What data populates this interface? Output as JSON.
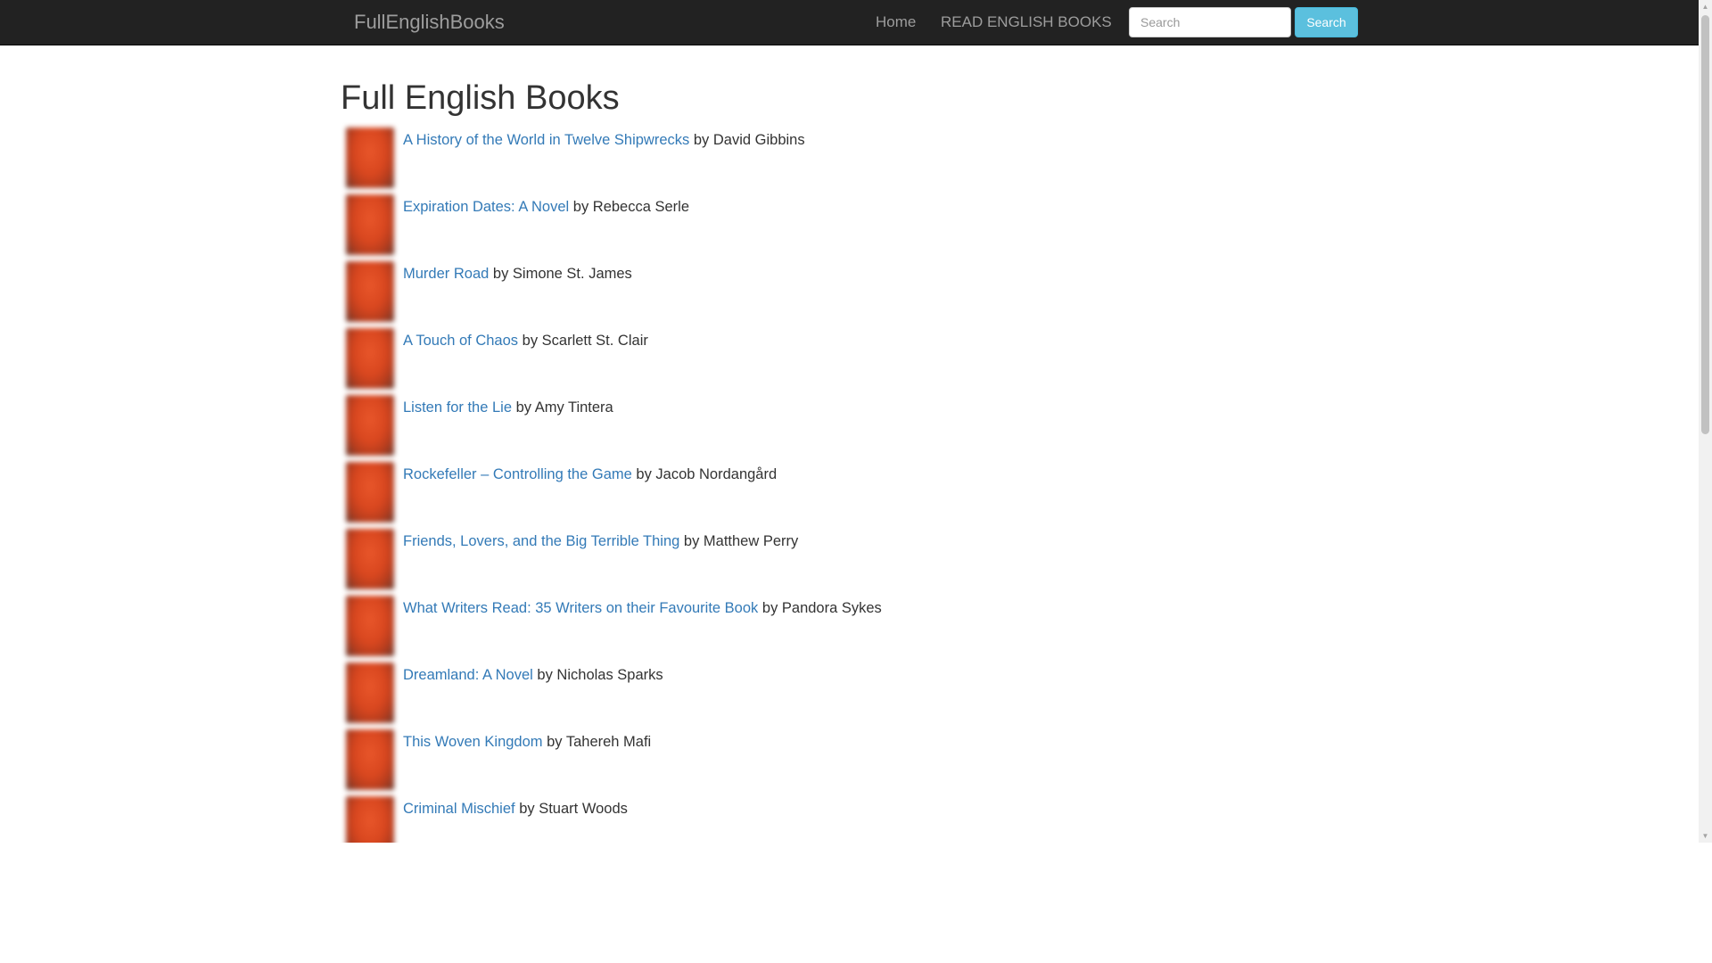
{
  "navbar": {
    "brand": "FullEnglishBooks",
    "links": [
      {
        "label": "Home"
      },
      {
        "label": "READ ENGLISH BOOKS"
      }
    ],
    "search": {
      "placeholder": "Search",
      "value": "",
      "button_label": "Search"
    }
  },
  "main": {
    "title": "Full English Books",
    "books": [
      {
        "title": "A History of the World in Twelve Shipwrecks",
        "author_text": "by David Gibbins"
      },
      {
        "title": "Expiration Dates: A Novel",
        "author_text": "by Rebecca Serle"
      },
      {
        "title": "Murder Road",
        "author_text": "by Simone St. James"
      },
      {
        "title": "A Touch of Chaos",
        "author_text": "by Scarlett St. Clair"
      },
      {
        "title": "Listen for the Lie",
        "author_text": "by Amy Tintera"
      },
      {
        "title": "Rockefeller – Controlling the Game",
        "author_text": "by Jacob Nordangård"
      },
      {
        "title": "Friends, Lovers, and the Big Terrible Thing",
        "author_text": "by Matthew Perry"
      },
      {
        "title": "What Writers Read: 35 Writers on their Favourite Book",
        "author_text": "by Pandora Sykes"
      },
      {
        "title": "Dreamland: A Novel",
        "author_text": "by Nicholas Sparks"
      },
      {
        "title": "This Woven Kingdom",
        "author_text": "by Tahereh Mafi"
      },
      {
        "title": "Criminal Mischief",
        "author_text": "by Stuart Woods"
      }
    ]
  },
  "colors": {
    "navbar_bg": "#222222",
    "link": "#337ab7",
    "search_button": "#5bc0de"
  }
}
